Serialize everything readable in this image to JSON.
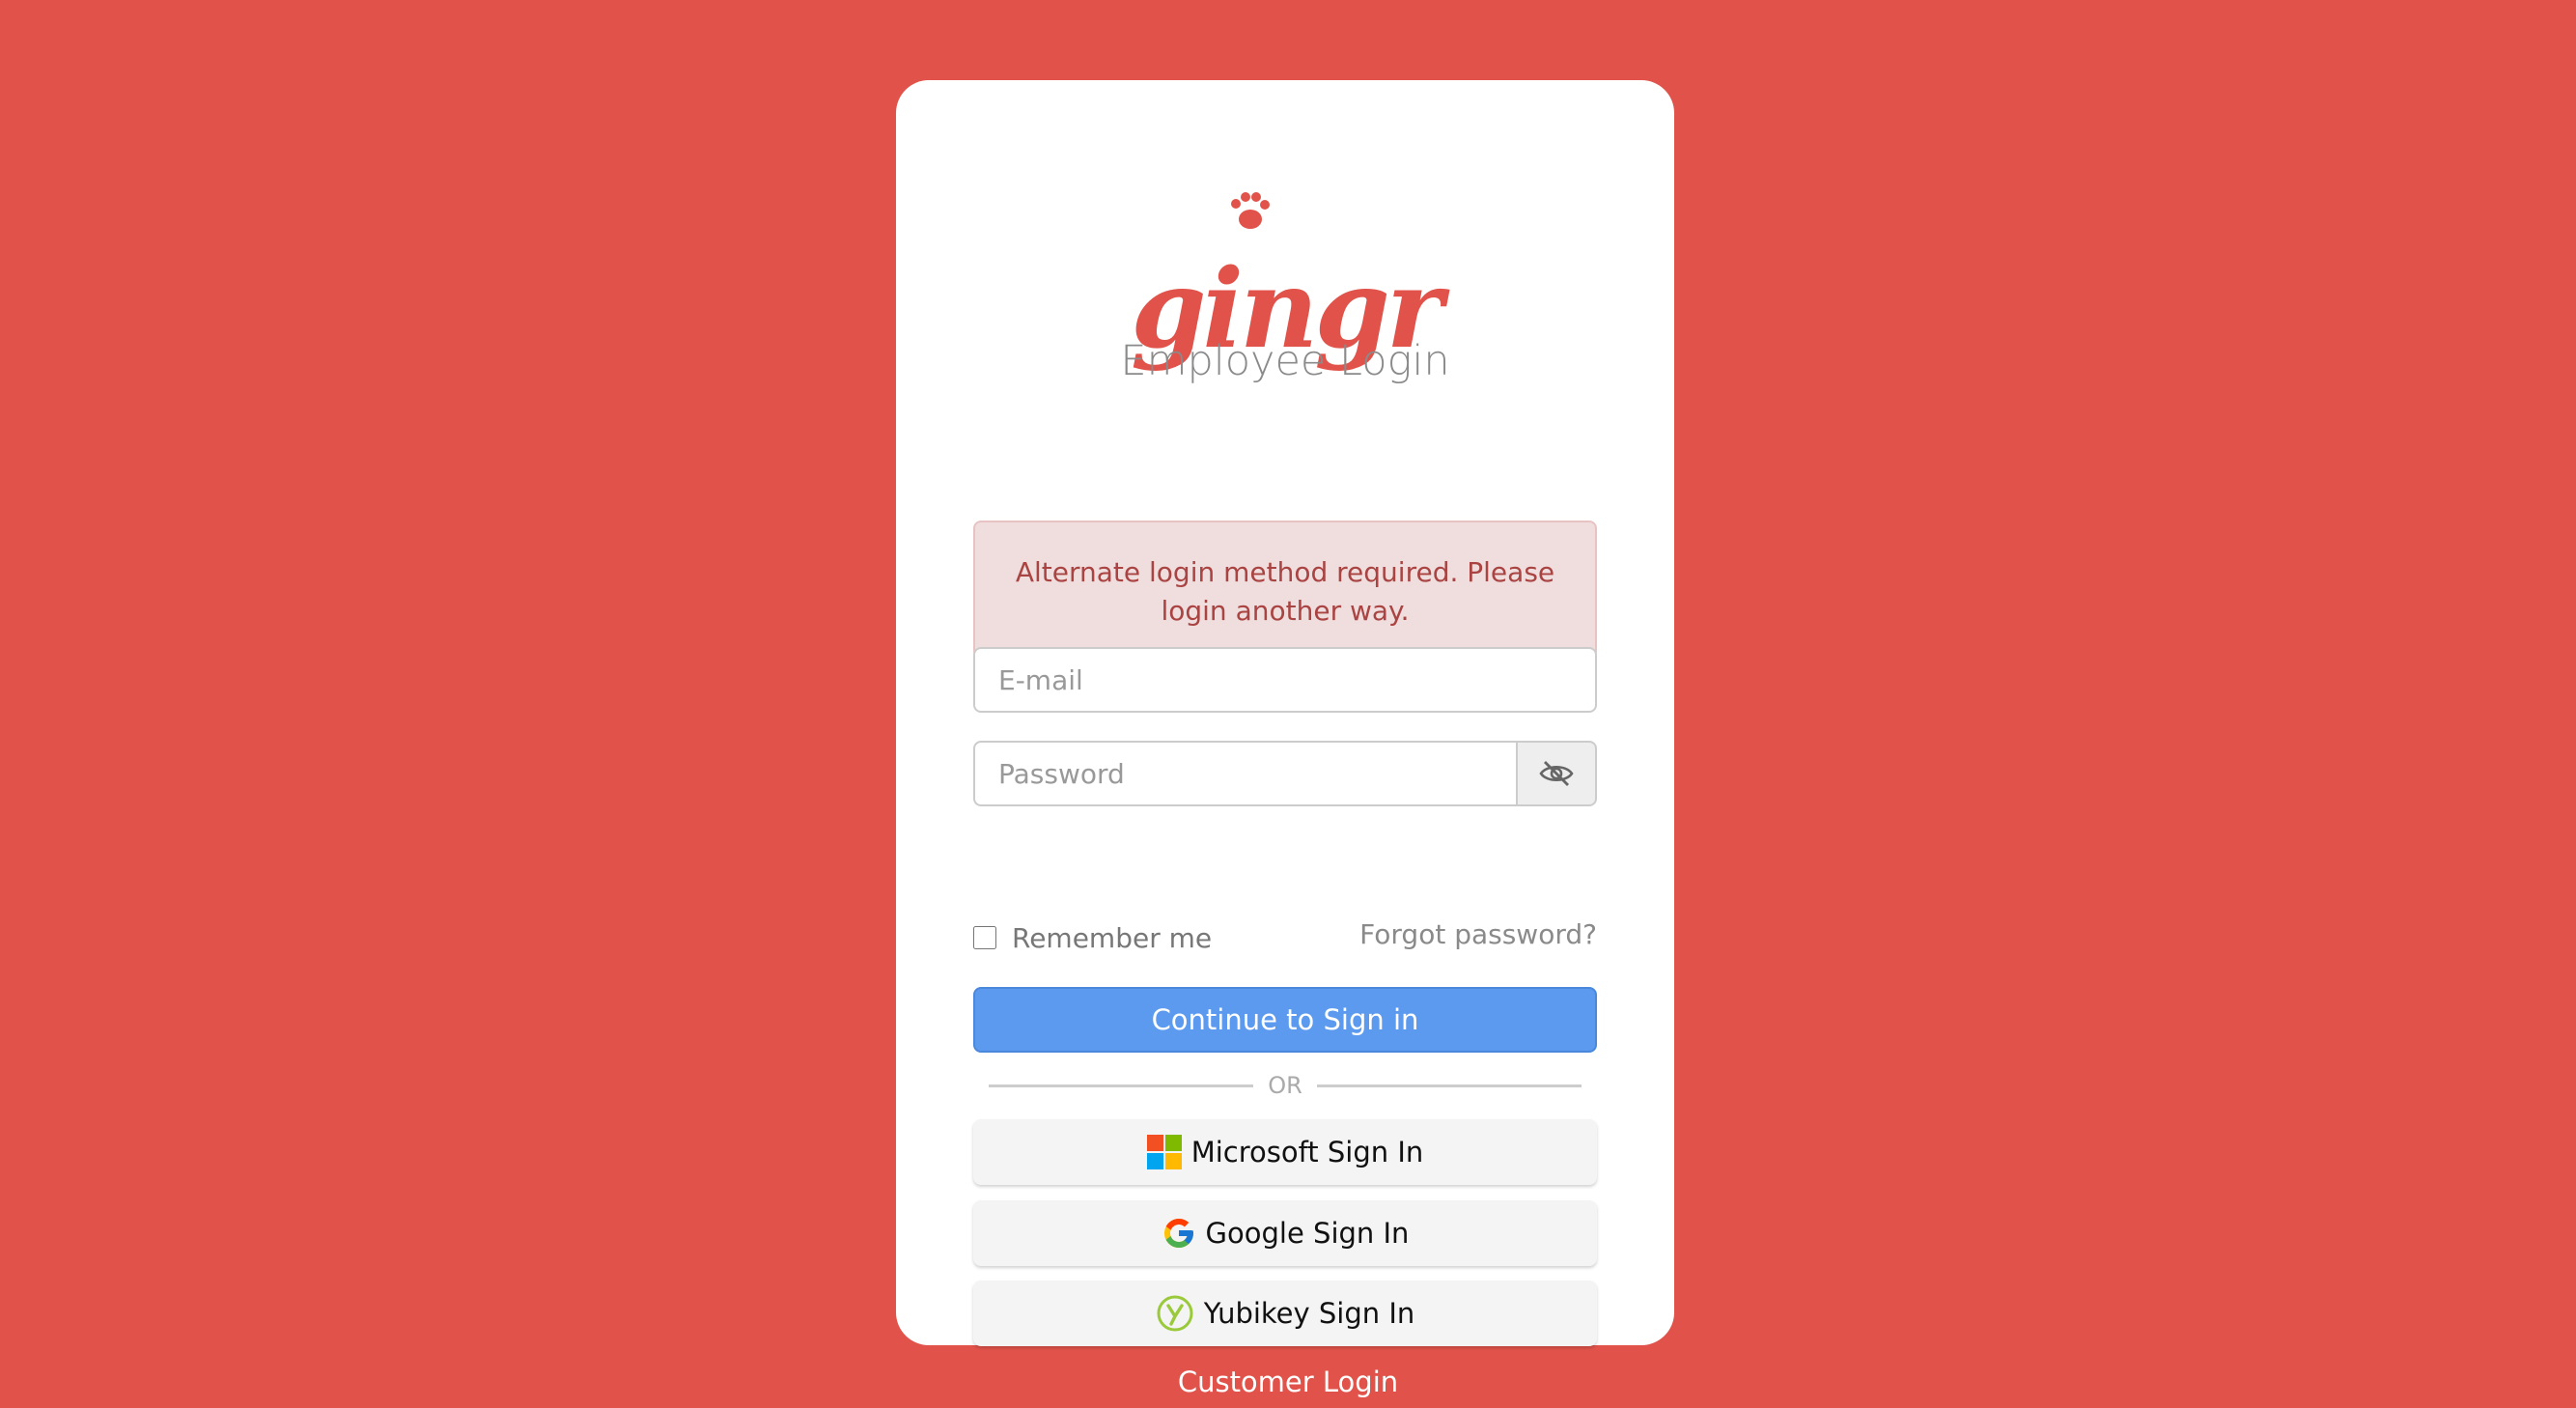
{
  "brand": {
    "logo_text": "gingr",
    "accent_color": "#e1534a"
  },
  "page": {
    "title": "Employee Login"
  },
  "alert": {
    "message": "Alternate login method required. Please login another way."
  },
  "form": {
    "email_placeholder": "E-mail",
    "password_placeholder": "Password",
    "toggle_icon": "eye-slash-icon",
    "remember_label": "Remember me",
    "forgot_label": "Forgot password?",
    "submit_label": "Continue to Sign in",
    "submit_color": "#5b9aee"
  },
  "divider": {
    "label": "OR"
  },
  "social": {
    "microsoft_label": "Microsoft Sign In",
    "google_label": "Google Sign In",
    "yubikey_label": "Yubikey Sign In"
  },
  "footer": {
    "customer_login_label": "Customer Login"
  }
}
